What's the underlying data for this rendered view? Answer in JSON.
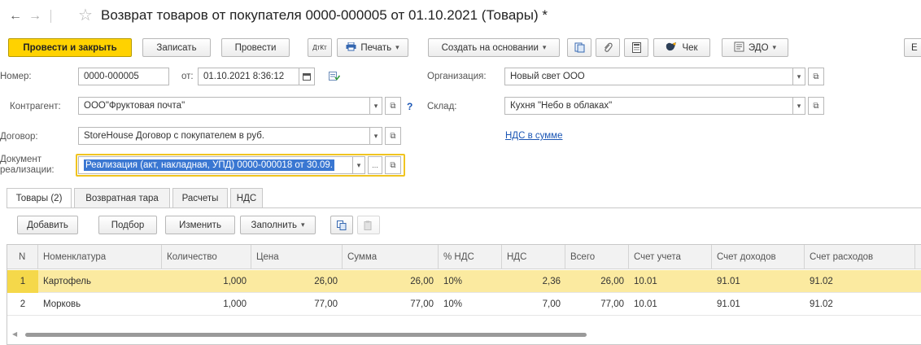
{
  "window": {
    "title": "Возврат товаров от покупателя 0000-000005 от 01.10.2021 (Товары) *",
    "back": "←",
    "forward": "→",
    "star": "☆"
  },
  "toolbar": {
    "post_close": "Провести и закрыть",
    "save": "Записать",
    "post": "Провести",
    "dtkt": "ДтКт",
    "print": "Печать",
    "create_based": "Создать на основании",
    "receipt": "Чек",
    "edo": "ЭДО",
    "more": "Е"
  },
  "form": {
    "number_label": "Номер:",
    "number": "0000-000005",
    "date_label": "от:",
    "date": "01.10.2021  8:36:12",
    "org_label": "Организация:",
    "org": "Новый свет ООО",
    "counterparty_label": "Контрагент:",
    "counterparty": "ООО\"Фруктовая почта\"",
    "warehouse_label": "Склад:",
    "warehouse": "Кухня \"Небо в облаках\"",
    "contract_label": "Договор:",
    "contract": "StoreHouse Договор с покупателем в руб.",
    "vat_link": "НДС в сумме",
    "doc_label_1": "Документ",
    "doc_label_2": "реализации:",
    "doc": "Реализация (акт, накладная, УПД) 0000-000018 от 30.09.",
    "help": "?",
    "ellipsis": "..."
  },
  "tabs": [
    {
      "label": "Товары (2)"
    },
    {
      "label": "Возвратная тара"
    },
    {
      "label": "Расчеты"
    },
    {
      "label": "НДС"
    }
  ],
  "table_toolbar": {
    "add": "Добавить",
    "pick": "Подбор",
    "change": "Изменить",
    "fill": "Заполнить"
  },
  "table": {
    "headers": [
      "N",
      "Номенклатура",
      "Количество",
      "Цена",
      "Сумма",
      "% НДС",
      "НДС",
      "Всего",
      "Счет учета",
      "Счет доходов",
      "Счет расходов"
    ],
    "rows": [
      [
        "1",
        "Картофель",
        "1,000",
        "26,00",
        "26,00",
        "10%",
        "2,36",
        "26,00",
        "10.01",
        "91.01",
        "91.02"
      ],
      [
        "2",
        "Морковь",
        "1,000",
        "77,00",
        "77,00",
        "10%",
        "7,00",
        "77,00",
        "10.01",
        "91.01",
        "91.02"
      ]
    ]
  },
  "colors": {
    "primary_button": "#ffd200",
    "selected_row": "#fbeaa0",
    "link": "#1a55b4",
    "selection": "#3a77d2"
  },
  "icons": [
    "arrow-left-icon",
    "arrow-right-icon",
    "star-icon",
    "printer-icon",
    "document-icon",
    "paperclip-icon",
    "calculator-icon",
    "receipt-icon",
    "edo-icon",
    "calendar-icon",
    "copy-icon",
    "paste-icon",
    "chevron-down-icon",
    "open-link-icon"
  ]
}
